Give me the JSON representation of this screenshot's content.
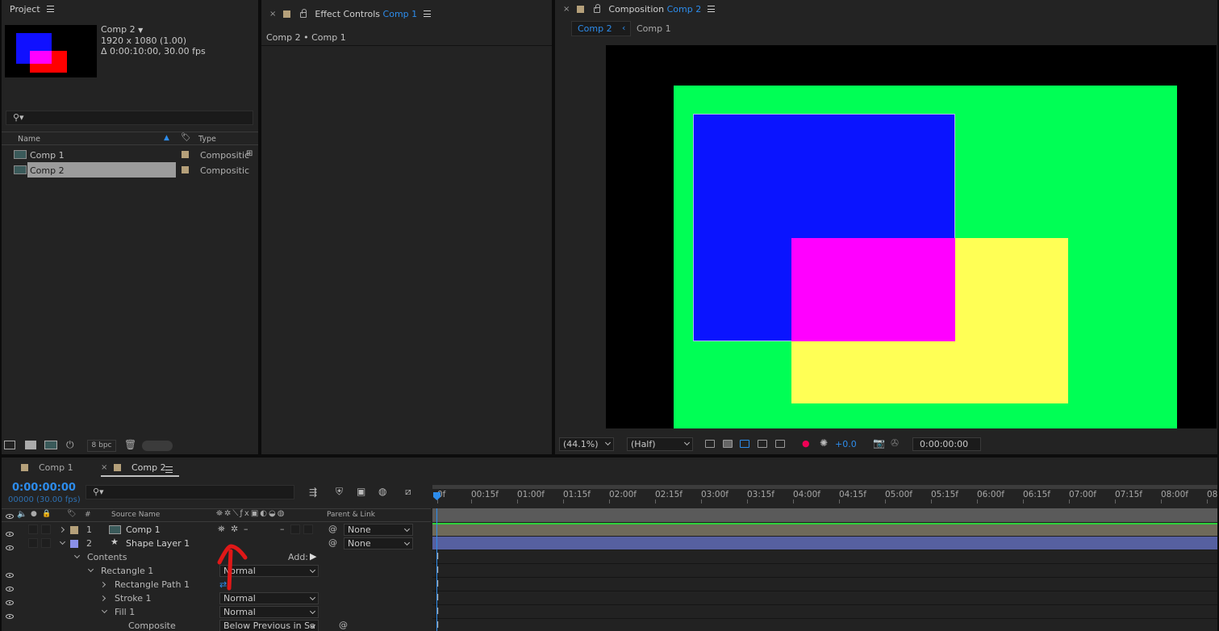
{
  "project": {
    "title": "Project",
    "comp_name": "Comp 2",
    "comp_size": "1920 x 1080 (1.00)",
    "comp_duration": "Δ 0:00:10:00, 30.00 fps",
    "col_name": "Name",
    "col_type": "Type",
    "items": [
      {
        "name": "Comp 1",
        "type": "Compositic"
      },
      {
        "name": "Comp 2",
        "type": "Compositic"
      }
    ],
    "bpc": "8 bpc"
  },
  "effect_controls": {
    "title": "Effect Controls",
    "title_target": "Comp 1",
    "breadcrumb": "Comp 2 • Comp 1"
  },
  "composition": {
    "title": "Composition",
    "title_target": "Comp 2",
    "tab_active": "Comp 2",
    "tab_other": "Comp 1",
    "zoom": "(44.1%)",
    "resolution": "(Half)",
    "exposure": "+0.0",
    "timecode": "0:00:00:00",
    "colors": {
      "bg": "#00ff55",
      "blue": "#0a14ff",
      "magenta": "#ff00ff",
      "yellow": "#ffff55"
    }
  },
  "timeline": {
    "tabs": [
      {
        "label": "Comp 1"
      },
      {
        "label": "Comp 2"
      }
    ],
    "timecode": "0:00:00:00",
    "frames": "00000 (30.00 fps)",
    "col_num": "#",
    "col_source": "Source Name",
    "col_parent": "Parent & Link",
    "ruler": [
      "0f",
      "00:15f",
      "01:00f",
      "01:15f",
      "02:00f",
      "02:15f",
      "03:00f",
      "03:15f",
      "04:00f",
      "04:15f",
      "05:00f",
      "05:15f",
      "06:00f",
      "06:15f",
      "07:00f",
      "07:15f",
      "08:00f",
      "08"
    ],
    "layers": [
      {
        "num": "1",
        "name": "Comp 1",
        "parent": "None"
      },
      {
        "num": "2",
        "name": "Shape Layer 1",
        "parent": "None"
      }
    ],
    "contents": "Contents",
    "add": "Add:",
    "props": [
      {
        "name": "Rectangle 1",
        "value": "Normal"
      },
      {
        "name": "Rectangle Path 1",
        "value": ""
      },
      {
        "name": "Stroke 1",
        "value": "Normal"
      },
      {
        "name": "Fill 1",
        "value": "Normal"
      },
      {
        "name": "Composite",
        "value": "Below Previous in Sa"
      }
    ]
  }
}
